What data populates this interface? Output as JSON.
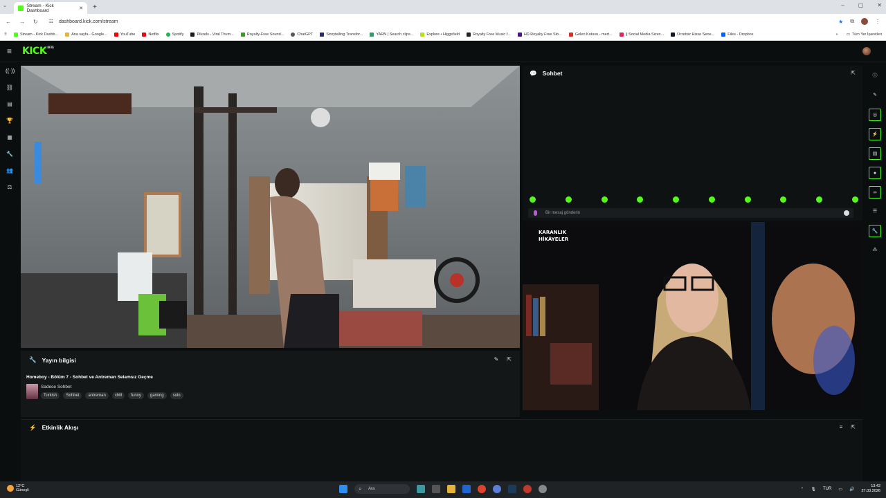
{
  "browser": {
    "tab_title": "Stream - Kick Dashboard",
    "url": "dashboard.kick.com/stream",
    "bookmarks": [
      "Stream - Kick Dashb...",
      "Ana sayfa - Google...",
      "YouTube",
      "Netflix",
      "Spotify",
      "Pikzels - Viral Thum...",
      "Royalty-Free Sound...",
      "ChatGPT",
      "Storytelling Transfor...",
      "YARN | Search clips...",
      "Explore • Higgsfield",
      "Royalty Free Music f...",
      "HD Royalty Free Sto...",
      "Gelen Kutusu - mert...",
      "|| Social Media Sizes...",
      "Ücretsiz Hisse Sene...",
      "Files - Dropbox"
    ],
    "other_bookmarks": "Tüm Yer İşaretleri"
  },
  "header": {
    "logo": "KICK",
    "logo_badge": "BETA"
  },
  "stream_info": {
    "panel_title": "Yayın bilgisi",
    "title": "Homeboy - Bölüm 7 - Sohbet ve Antreman Selamsız Geçme",
    "category": "Sadece Sohbet",
    "tags": [
      "Turkish",
      "Sohbet",
      "antreman",
      "chill",
      "funny",
      "gaming",
      "solo"
    ]
  },
  "activity": {
    "panel_title": "Etkinlik Akışı"
  },
  "chat": {
    "panel_title": "Sohbet",
    "input_placeholder": "Bir mesaj gönderin",
    "emote_count": 10
  },
  "overlay": {
    "title": "KARANLIK\nHİKÂYELER"
  },
  "taskbar": {
    "weather_temp": "12°C",
    "weather_desc": "Güneşli",
    "search_label": "Ara",
    "language": "TUR",
    "time": "13:42",
    "date": "27.03.2026"
  },
  "colors": {
    "accent": "#53fc18",
    "background": "#0b0e0f",
    "panel": "#141718"
  }
}
